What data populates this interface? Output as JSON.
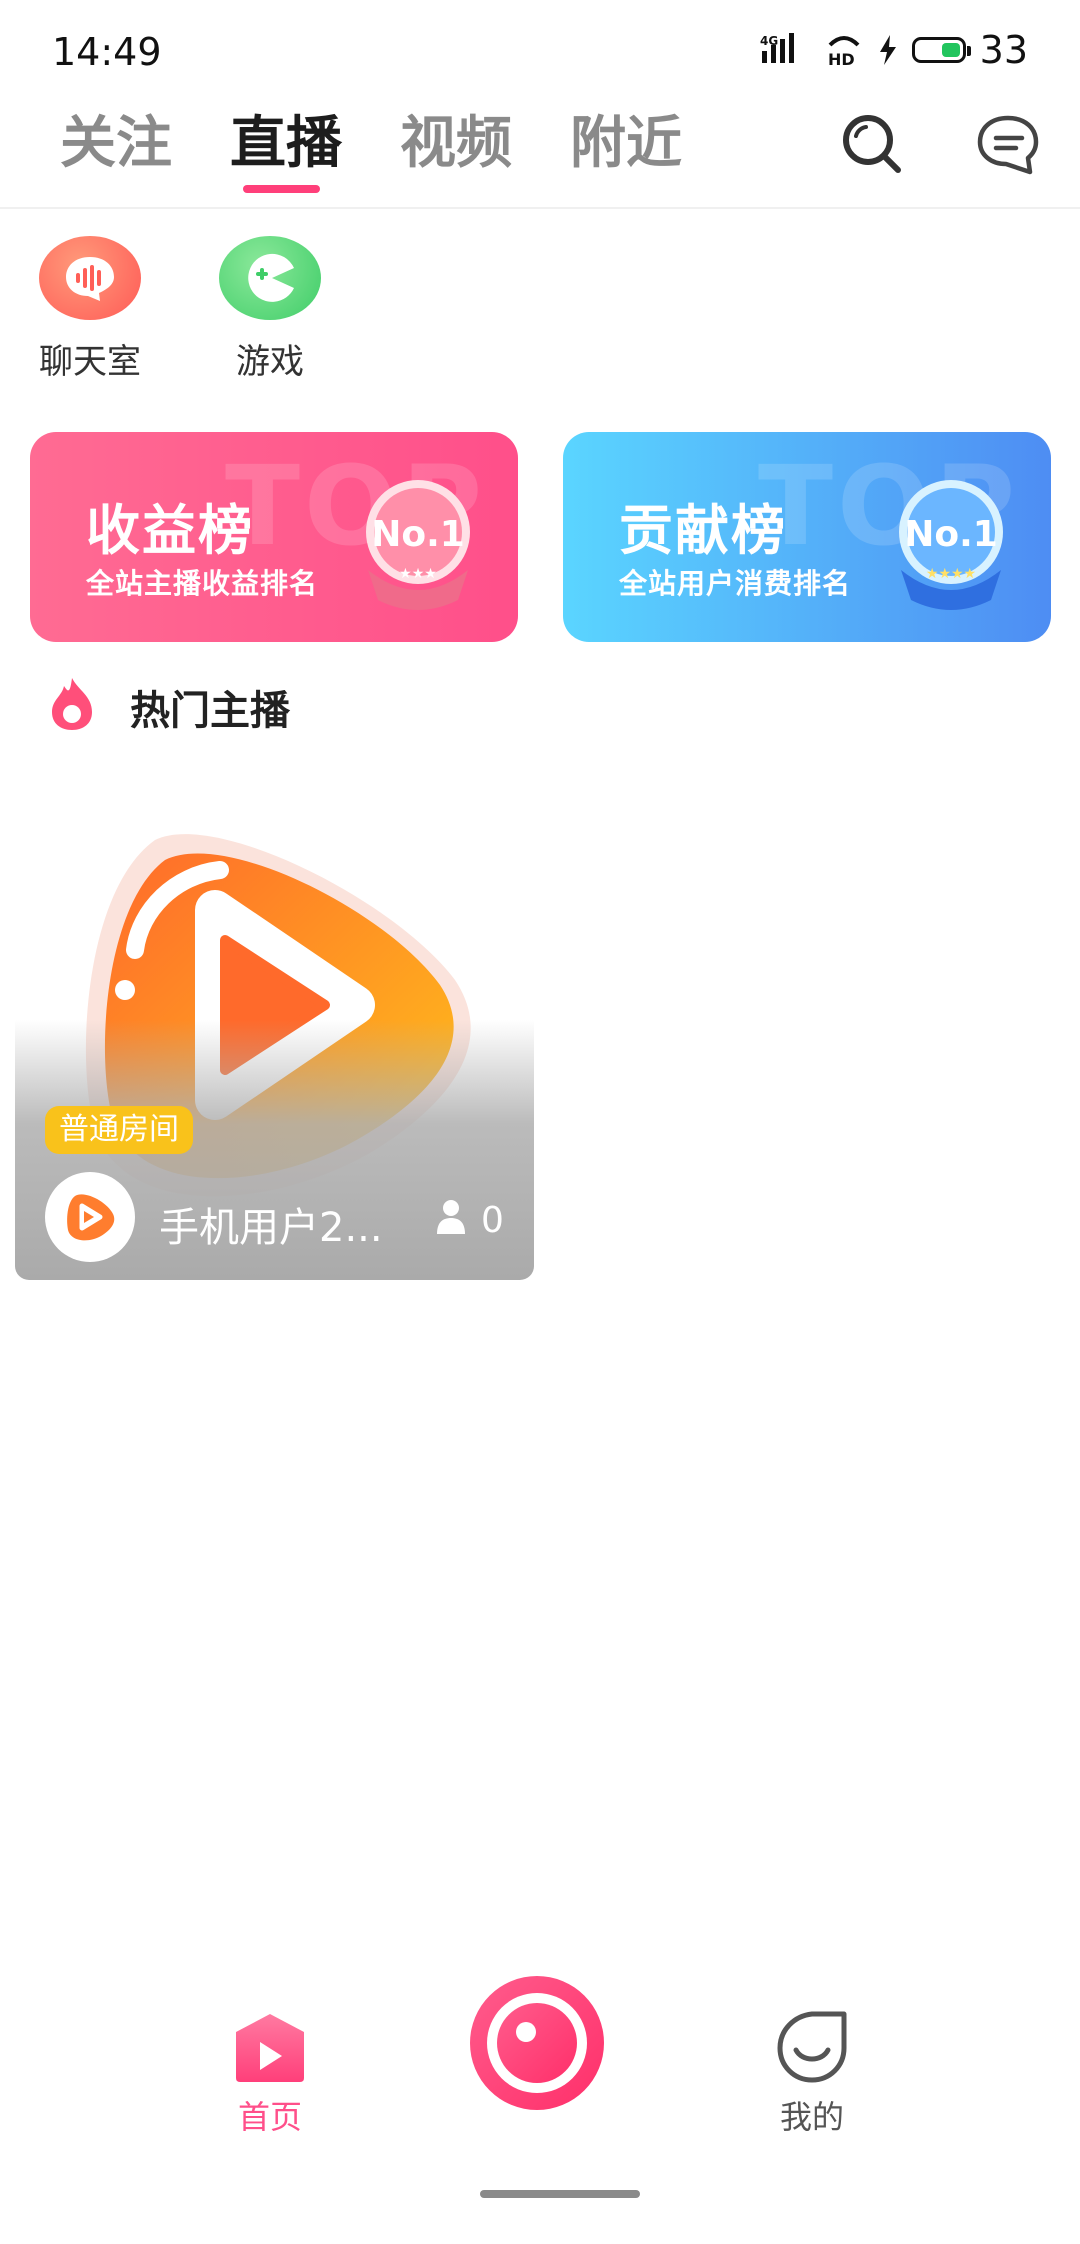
{
  "status_bar": {
    "time": "14:49",
    "network": "4G",
    "hd": "HD",
    "battery": "33"
  },
  "tabs": [
    {
      "label": "关注",
      "active": false
    },
    {
      "label": "直播",
      "active": true
    },
    {
      "label": "视频",
      "active": false
    },
    {
      "label": "附近",
      "active": false
    }
  ],
  "header_icons": [
    "search-icon",
    "message-icon"
  ],
  "quick_entries": [
    {
      "label": "聊天室",
      "icon": "voice-chat-icon",
      "color": "#ff6d5c"
    },
    {
      "label": "游戏",
      "icon": "game-icon",
      "color": "#4ed677"
    }
  ],
  "banners": [
    {
      "title": "收益榜",
      "subtitle": "全站主播收益排名",
      "watermark": "TOP",
      "medal": "No.1",
      "color": "#ff5b8c"
    },
    {
      "title": "贡献榜",
      "subtitle": "全站用户消费排名",
      "watermark": "TOP",
      "medal": "No.1",
      "color": "#53b0f8"
    }
  ],
  "hot": {
    "title": "热门主播"
  },
  "live_cards": [
    {
      "badge": "普通房间",
      "name": "手机用户2...",
      "viewers": "0"
    }
  ],
  "bottom_nav": {
    "home_label": "首页",
    "mine_label": "我的"
  },
  "colors": {
    "accent": "#ff3f7a",
    "badge": "#f9c21b"
  }
}
